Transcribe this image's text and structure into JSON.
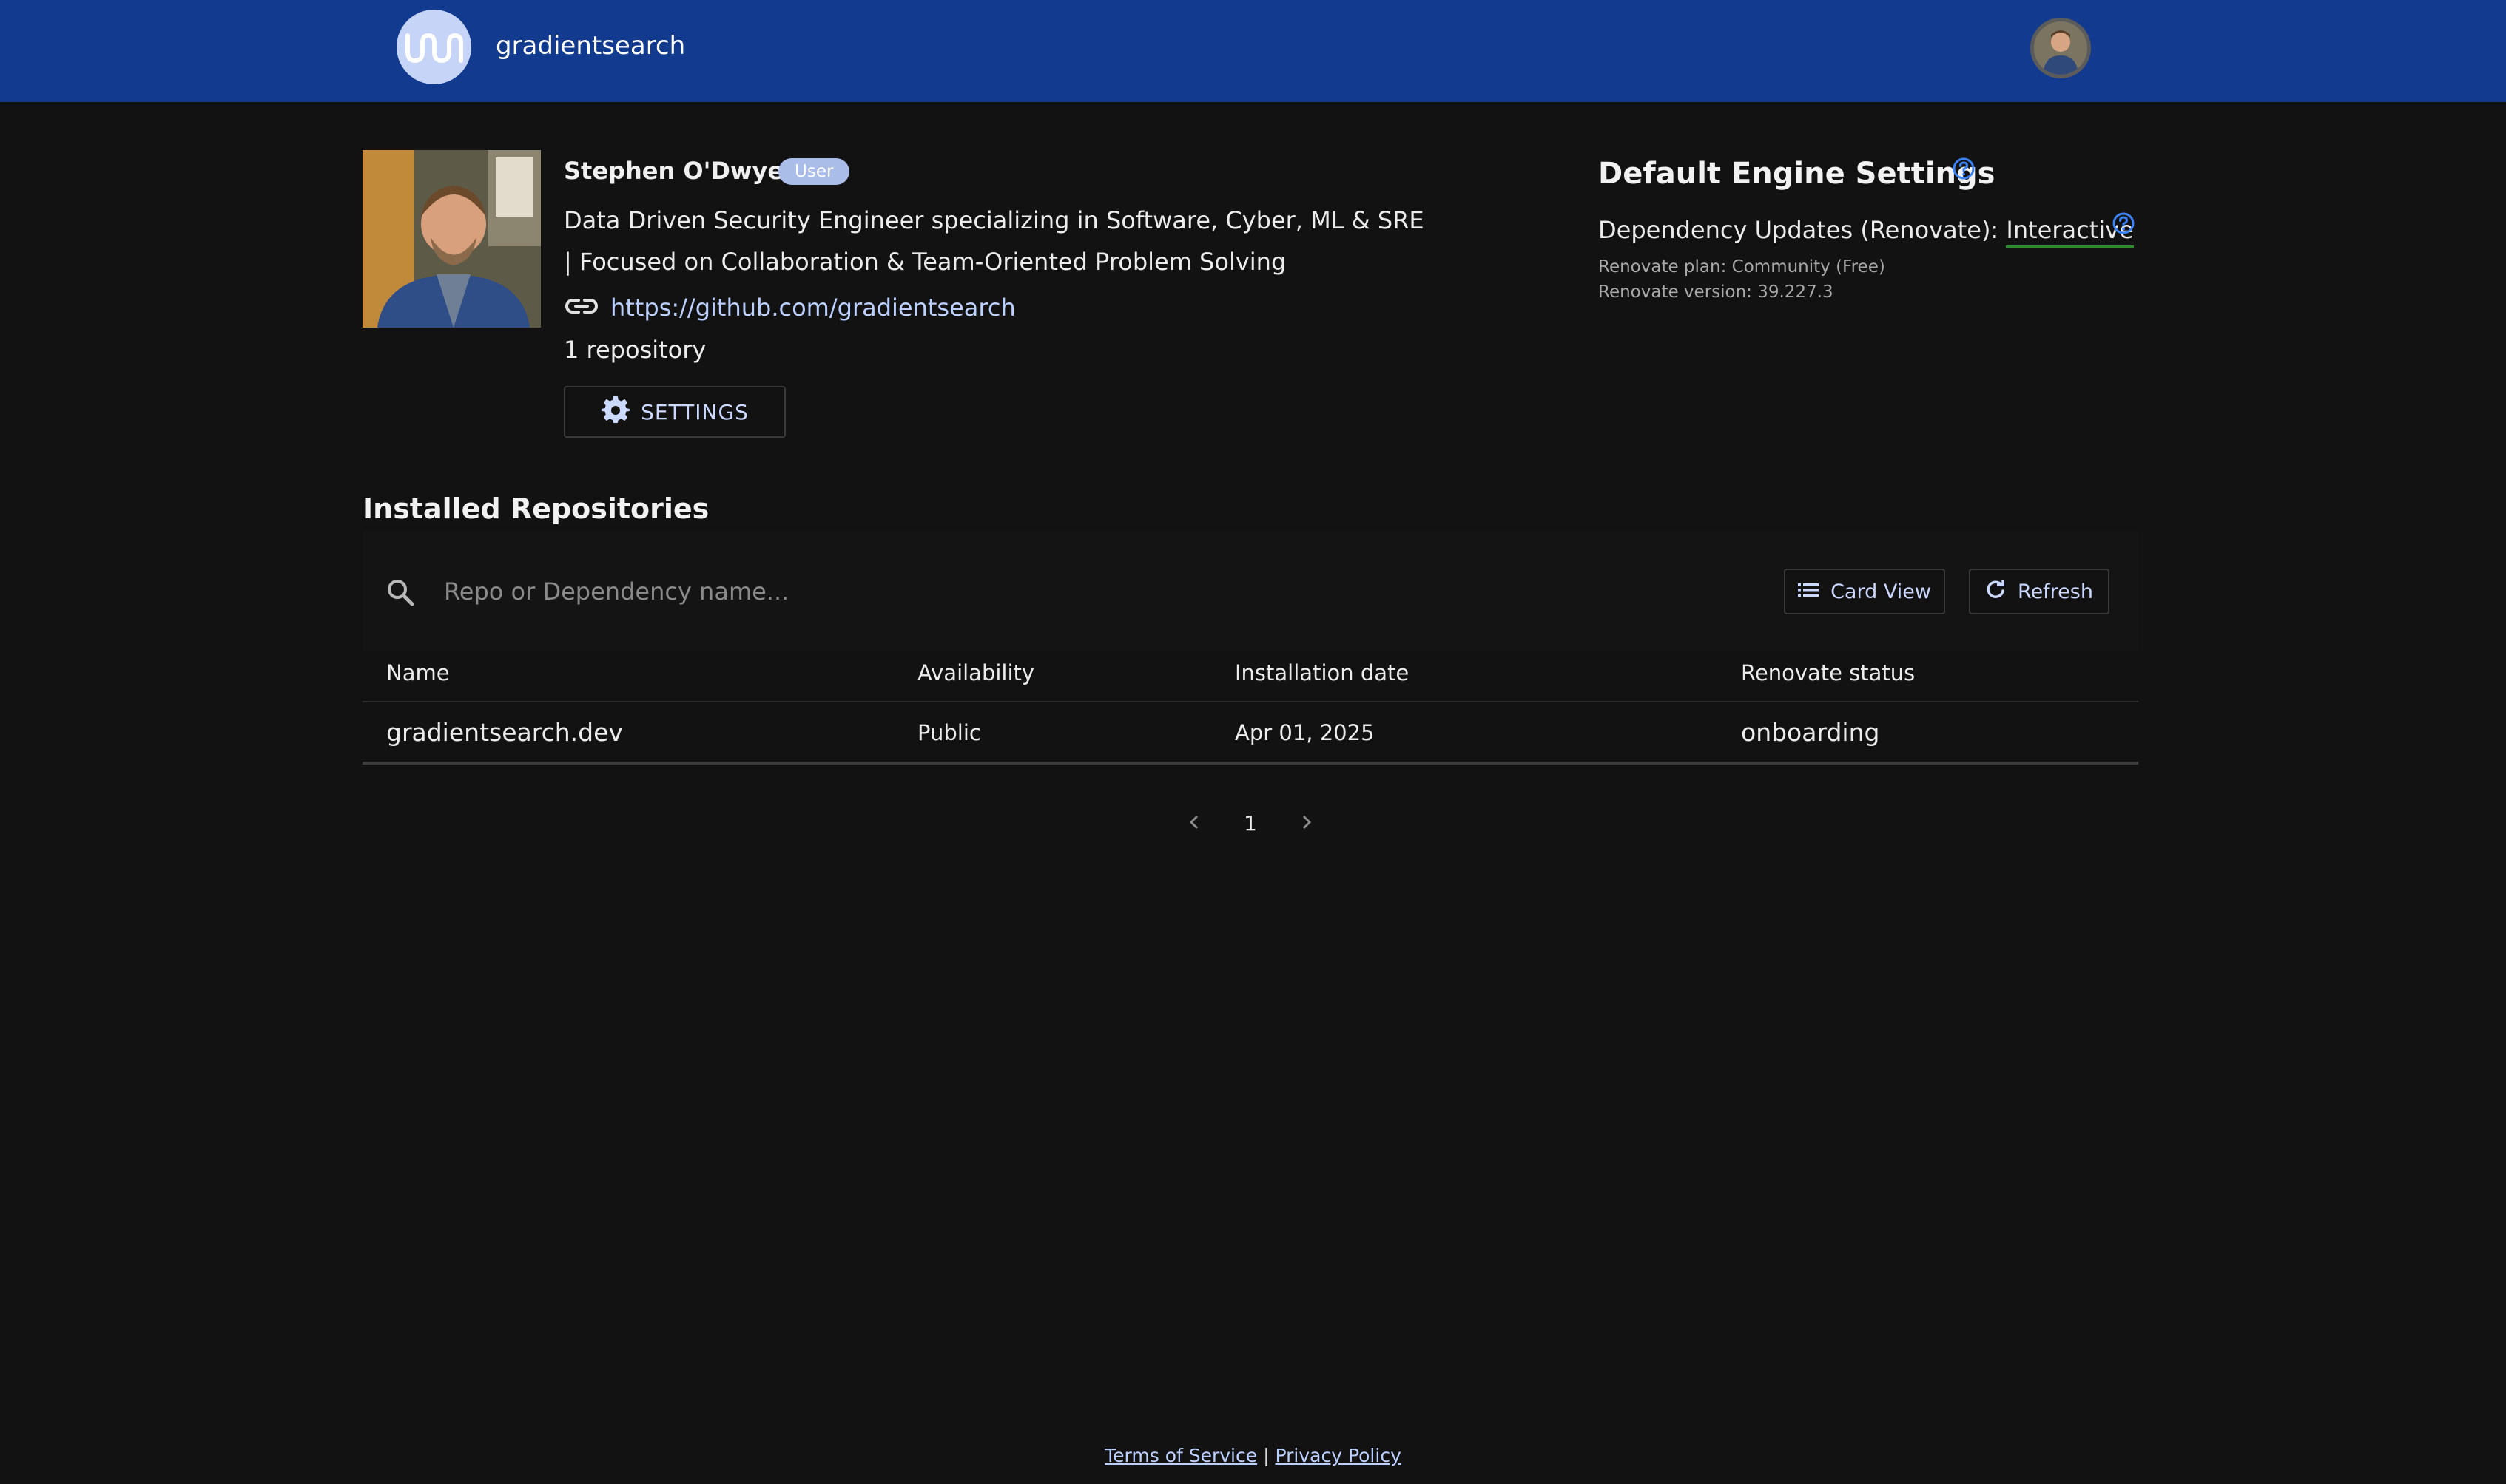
{
  "header": {
    "brand": "gradientsearch",
    "logo_icon": "wave-logo-icon",
    "avatar_icon": "user-avatar-icon"
  },
  "profile": {
    "name": "Stephen O'Dwyer",
    "badge": "User",
    "bio": "Data Driven Security Engineer specializing in Software, Cyber, ML & SRE | Focused on Collaboration & Team-Oriented Problem Solving",
    "link": "https://github.com/gradientsearch",
    "repo_count": "1 repository",
    "settings_label": "SETTINGS"
  },
  "engine": {
    "title": "Default Engine Settings",
    "dependency_label": "Dependency Updates (Renovate): ",
    "dependency_value": "Interactive",
    "plan": "Renovate plan: Community (Free)",
    "version": "Renovate version: 39.227.3"
  },
  "repositories": {
    "title": "Installed Repositories",
    "search_placeholder": "Repo or Dependency name...",
    "card_view_label": "Card View",
    "refresh_label": "Refresh",
    "columns": [
      "Name",
      "Availability",
      "Installation date",
      "Renovate status"
    ],
    "rows": [
      {
        "name": "gradientsearch.dev",
        "availability": "Public",
        "installed": "Apr 01, 2025",
        "status": "onboarding"
      }
    ],
    "current_page": "1"
  },
  "footer": {
    "terms": "Terms of Service",
    "separator": "|",
    "privacy": "Privacy Policy"
  },
  "colors": {
    "topbar": "#123a8e",
    "background": "#121212",
    "accent_link": "#bcd0ff",
    "help_icon": "#3b82f6",
    "underline_green": "#2e8b2e"
  }
}
